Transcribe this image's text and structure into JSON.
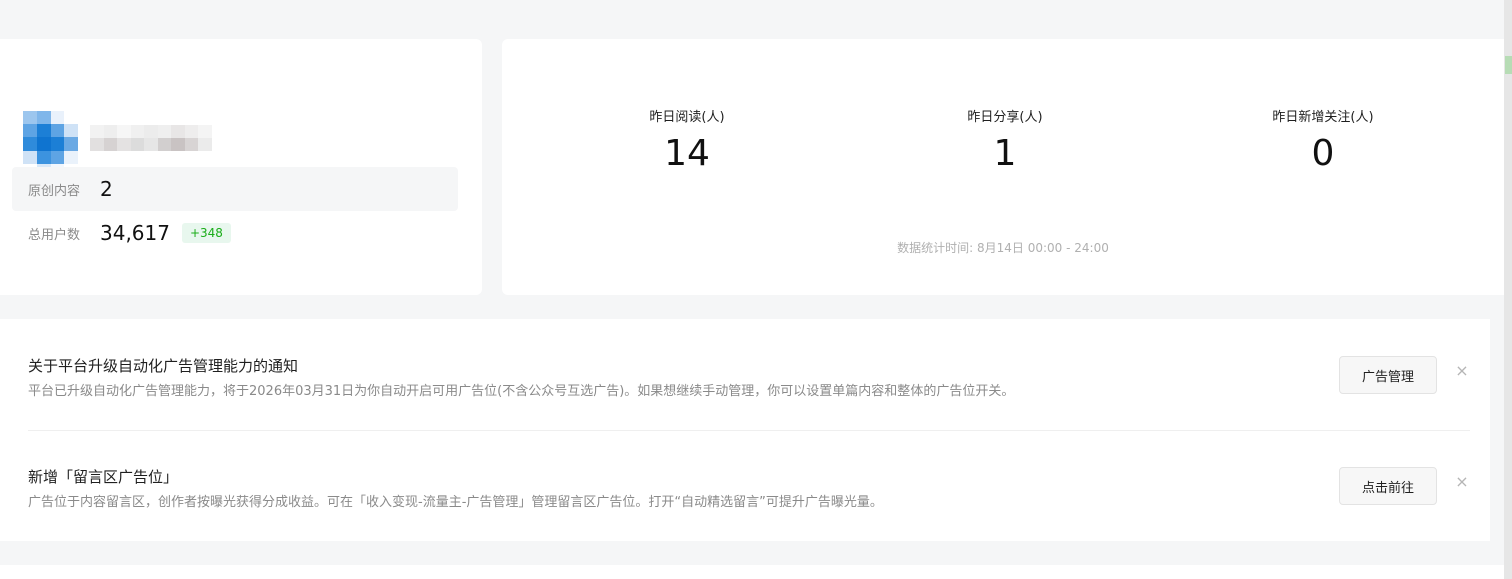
{
  "account": {
    "avatar_icon": "avatar-mosaic-icon",
    "nickname_icon": "blurred-nickname-icon",
    "original_content_label": "原创内容",
    "original_content_value": "2",
    "total_users_label": "总用户数",
    "total_users_value": "34,617",
    "total_users_delta": "+348",
    "colors": {
      "delta_bg": "#e8f7ee",
      "delta_text": "#1aad19",
      "avatar_blue": "#1c7fd6"
    }
  },
  "stats": {
    "metrics": [
      {
        "label": "昨日阅读(人)",
        "value": "14"
      },
      {
        "label": "昨日分享(人)",
        "value": "1"
      },
      {
        "label": "昨日新增关注(人)",
        "value": "0"
      }
    ],
    "time_note": "数据统计时间: 8月14日 00:00 - 24:00"
  },
  "notices": [
    {
      "title": "关于平台升级自动化广告管理能力的通知",
      "desc": "平台已升级自动化广告管理能力，将于2026年03月31日为你自动开启可用广告位(不含公众号互选广告)。如果想继续手动管理，你可以设置单篇内容和整体的广告位开关。",
      "button": "广告管理",
      "close": "×"
    },
    {
      "title": "新增「留言区广告位」",
      "desc": "广告位于内容留言区，创作者按曝光获得分成收益。可在「收入变现-流量主-广告管理」管理留言区广告位。打开“自动精选留言”可提升广告曝光量。",
      "button": "点击前往",
      "close": "×"
    }
  ]
}
